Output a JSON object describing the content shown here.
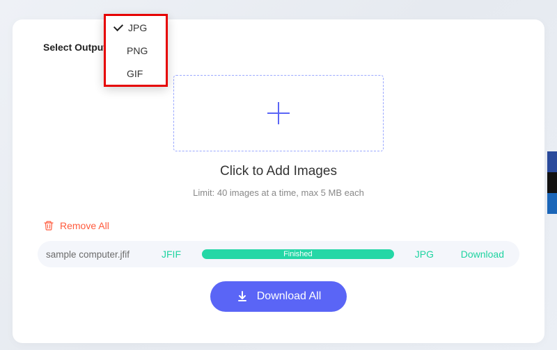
{
  "select_output_label": "Select Output",
  "format_options": {
    "jpg": "JPG",
    "png": "PNG",
    "gif": "GIF"
  },
  "selected_format": "JPG",
  "dropzone": {
    "title": "Click to Add Images",
    "limit": "Limit: 40 images at a time, max 5 MB each"
  },
  "remove_all_label": "Remove All",
  "file": {
    "name": "sample computer.jfif",
    "source_format": "JFIF",
    "status_text": "Finished",
    "target_format": "JPG",
    "download_label": "Download"
  },
  "download_all_label": "Download All",
  "colors": {
    "accent_blue": "#5a65f6",
    "success_green": "#1ed3a0",
    "danger_red": "#ff5a3c",
    "highlight_border": "#e60000"
  }
}
